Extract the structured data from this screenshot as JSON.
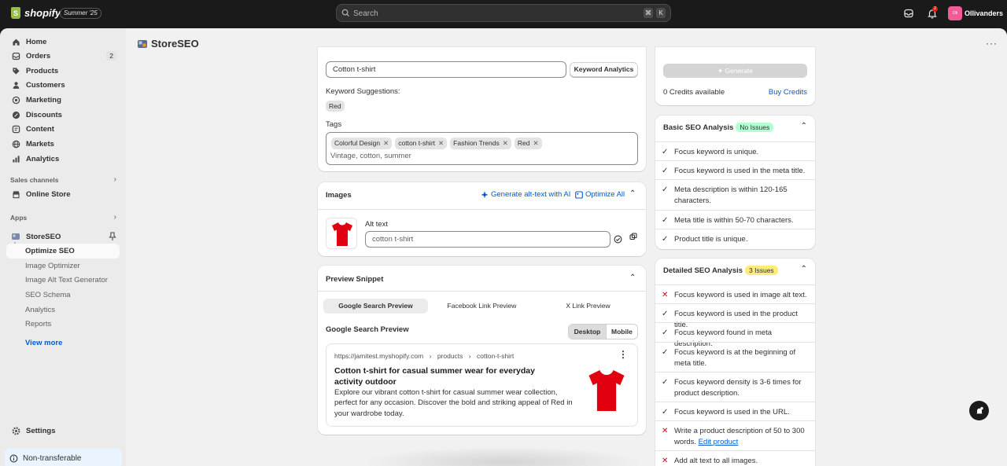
{
  "topbar": {
    "logo_text": "shopify",
    "edition": "Summer '25",
    "search_placeholder": "Search",
    "shortcut_key1": "⌘",
    "shortcut_key2": "K",
    "notification_count": "2",
    "store_initials": "Oli",
    "store_name": "Ollivanders"
  },
  "sidebar": {
    "nav": [
      {
        "label": "Home",
        "icon": "home-icon"
      },
      {
        "label": "Orders",
        "icon": "orders-icon",
        "count": "2"
      },
      {
        "label": "Products",
        "icon": "tag-icon"
      },
      {
        "label": "Customers",
        "icon": "person-icon"
      },
      {
        "label": "Marketing",
        "icon": "target-icon"
      },
      {
        "label": "Discounts",
        "icon": "discount-icon"
      },
      {
        "label": "Content",
        "icon": "content-icon"
      },
      {
        "label": "Markets",
        "icon": "globe-icon"
      },
      {
        "label": "Analytics",
        "icon": "chart-icon"
      }
    ],
    "sales_channels_label": "Sales channels",
    "online_store_label": "Online Store",
    "apps_label": "Apps",
    "app_name": "StoreSEO",
    "app_subitems": [
      "Optimize SEO",
      "Image Optimizer",
      "Image Alt Text Generator",
      "SEO Schema",
      "Analytics",
      "Reports"
    ],
    "view_more": "View more",
    "settings_label": "Settings",
    "non_transferable": "Non-transferable"
  },
  "page": {
    "title": "StoreSEO"
  },
  "keyword_card": {
    "focus_keyword_value": "Cotton t-shirt",
    "keyword_analytics_button": "Keyword Analytics",
    "suggestions_label": "Keyword Suggestions:",
    "suggestion": "Red",
    "tags_label": "Tags",
    "tags": [
      "Colorful Design",
      "cotton t-shirt",
      "Fashion Trends",
      "Red"
    ],
    "tags_placeholder": "Vintage, cotton, summer"
  },
  "images_card": {
    "title": "Images",
    "generate_alt": "Generate alt-text with AI",
    "optimize_all": "Optimize All",
    "alt_text_label": "Alt text",
    "alt_text_value": "cotton t-shirt"
  },
  "preview_card": {
    "title": "Preview Snippet",
    "tabs": [
      "Google Search Preview",
      "Facebook Link Preview",
      "X Link Preview"
    ],
    "section_title": "Google Search Preview",
    "device_desktop": "Desktop",
    "device_mobile": "Mobile",
    "url": "https://jamitest.myshopify.com",
    "crumb1": "products",
    "crumb2": "cotton-t-shirt",
    "result_title": "Cotton t-shirt for casual summer wear for everyday activity outdoor",
    "result_desc": "Explore our vibrant cotton t-shirt for casual summer wear collection, perfect for any occasion. Discover the bold and striking appeal of Red in your wardrobe today."
  },
  "credits_card": {
    "generate_button": "Generate",
    "credits_text": "0 Credits available",
    "buy_credits": "Buy Credits"
  },
  "basic_analysis": {
    "title": "Basic SEO Analysis",
    "badge": "No Issues",
    "items": [
      "Focus keyword is unique.",
      "Focus keyword is used in the meta title.",
      "Meta description is within 120-165 characters.",
      "Meta title is within 50-70 characters.",
      "Product title is unique."
    ]
  },
  "detailed_analysis": {
    "title": "Detailed SEO Analysis",
    "badge": "3 Issues",
    "items": [
      {
        "text": "Focus keyword is used in image alt text.",
        "status": "fail"
      },
      {
        "text": "Focus keyword is used in the product title.",
        "status": "pass"
      },
      {
        "text": "Focus keyword found in meta description.",
        "status": "pass"
      },
      {
        "text": "Focus keyword is at the beginning of meta title.",
        "status": "pass"
      },
      {
        "text": "Focus keyword density is 3-6 times for product description.",
        "status": "pass"
      },
      {
        "text": "Focus keyword is used in the URL.",
        "status": "pass"
      },
      {
        "text": "Write a product description of 50 to 300 words.",
        "status": "fail",
        "link": "Edit product"
      },
      {
        "text": "Add alt text to all images.",
        "status": "fail"
      }
    ]
  },
  "colors": {
    "accent": "#005bd3",
    "success_badge": "#b4fed2",
    "warning_badge": "#ffeb78",
    "fail": "#c70a24",
    "product": "#e0000f"
  }
}
